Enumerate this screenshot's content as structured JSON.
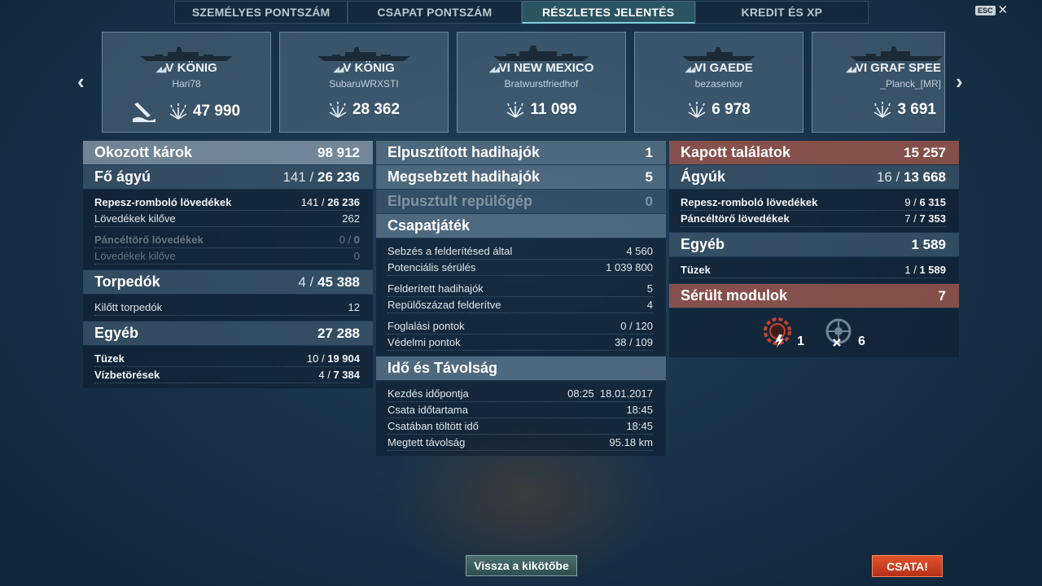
{
  "tabs": [
    {
      "label": "SZEMÉLYES PONTSZÁM",
      "active": false
    },
    {
      "label": "CSAPAT PONTSZÁM",
      "active": false
    },
    {
      "label": "RÉSZLETES JELENTÉS",
      "active": true
    },
    {
      "label": "KREDIT ÉS XP",
      "active": false
    }
  ],
  "esc": {
    "key": "ESC",
    "close": "✕"
  },
  "nav": {
    "prev": "‹",
    "next": "›"
  },
  "ships": [
    {
      "name": "V KÖNIG",
      "player": "Hari78",
      "damage": "47 990",
      "sunk_icon": true
    },
    {
      "name": "V KÖNIG",
      "player": "SubaruWRXSTI",
      "damage": "28 362",
      "sunk_icon": false
    },
    {
      "name": "VI NEW MEXICO",
      "player": "Bratwurstfriedhof",
      "damage": "11 099",
      "sunk_icon": false
    },
    {
      "name": "VI GAEDE",
      "player": "bezasenior",
      "damage": "6 978",
      "sunk_icon": false
    },
    {
      "name": "VI GRAF SPEE",
      "player": "_Planck_[MR]",
      "damage": "3 691",
      "sunk_icon": false
    }
  ],
  "left": {
    "damage_header": {
      "label": "Okozott károk",
      "value": "98 912"
    },
    "main_guns": {
      "label": "Fő ágyú",
      "hits": "141",
      "value": "26 236"
    },
    "he": {
      "label": "Repesz-romboló lövedékek",
      "hits": "141",
      "value": "26 236"
    },
    "he_fired": {
      "label": "Lövedékek kilőve",
      "value": "262"
    },
    "ap": {
      "label": "Páncéltörő lövedékek",
      "hits": "0",
      "value": "0"
    },
    "ap_fired": {
      "label": "Lövedékek kilőve",
      "value": "0"
    },
    "torpedoes": {
      "label": "Torpedók",
      "hits": "4",
      "value": "45 388"
    },
    "torp_fired": {
      "label": "Kilőtt torpedók",
      "value": "12"
    },
    "other": {
      "label": "Egyéb",
      "value": "27 288"
    },
    "fires": {
      "label": "Tüzek",
      "hits": "10",
      "value": "19 904"
    },
    "floods": {
      "label": "Vízbetörések",
      "hits": "4",
      "value": "7 384"
    }
  },
  "mid": {
    "destroyed": {
      "label": "Elpusztított hadihajók",
      "value": "1"
    },
    "damaged": {
      "label": "Megsebzett hadihajók",
      "value": "5"
    },
    "planes": {
      "label": "Elpusztult repülőgép",
      "value": "0"
    },
    "teamplay": {
      "label": "Csapatjáték"
    },
    "spotting_dmg": {
      "label": "Sebzés a felderítésed által",
      "value": "4 560"
    },
    "potential": {
      "label": "Potenciális sérülés",
      "value": "1 039 800"
    },
    "spotted_ships": {
      "label": "Felderített hadihajók",
      "value": "5"
    },
    "spotted_planes": {
      "label": "Repülőszázad felderítve",
      "value": "4"
    },
    "capture": {
      "label": "Foglalási pontok",
      "value": "0 / 120"
    },
    "defense": {
      "label": "Védelmi pontok",
      "value": "38 / 109"
    },
    "time_header": {
      "label": "Idő és Távolság"
    },
    "start": {
      "label": "Kezdés időpontja",
      "value": "08:25  18.01.2017"
    },
    "duration": {
      "label": "Csata időtartama",
      "value": "18:45"
    },
    "time_in_battle": {
      "label": "Csatában töltött idő",
      "value": "18:45"
    },
    "distance": {
      "label": "Megtett távolság",
      "value": "95.18 km"
    }
  },
  "right": {
    "received": {
      "label": "Kapott találatok",
      "value": "15 257"
    },
    "guns": {
      "label": "Ágyúk",
      "hits": "16",
      "value": "13 668"
    },
    "he": {
      "label": "Repesz-romboló lövedékek",
      "hits": "9",
      "value": "6 315"
    },
    "ap": {
      "label": "Páncéltörő lövedékek",
      "hits": "7",
      "value": "7 353"
    },
    "other": {
      "label": "Egyéb",
      "value": "1 589"
    },
    "fires": {
      "label": "Tüzek",
      "hits": "1",
      "value": "1 589"
    },
    "modules": {
      "label": "Sérült modulok",
      "value": "7"
    },
    "module_icons": [
      {
        "icon": "engine-damaged-icon",
        "count": "1"
      },
      {
        "icon": "steering-destroyed-icon",
        "count": "6"
      }
    ]
  },
  "buttons": {
    "back": "Vissza a kikötőbe",
    "battle": "CSATA!"
  }
}
